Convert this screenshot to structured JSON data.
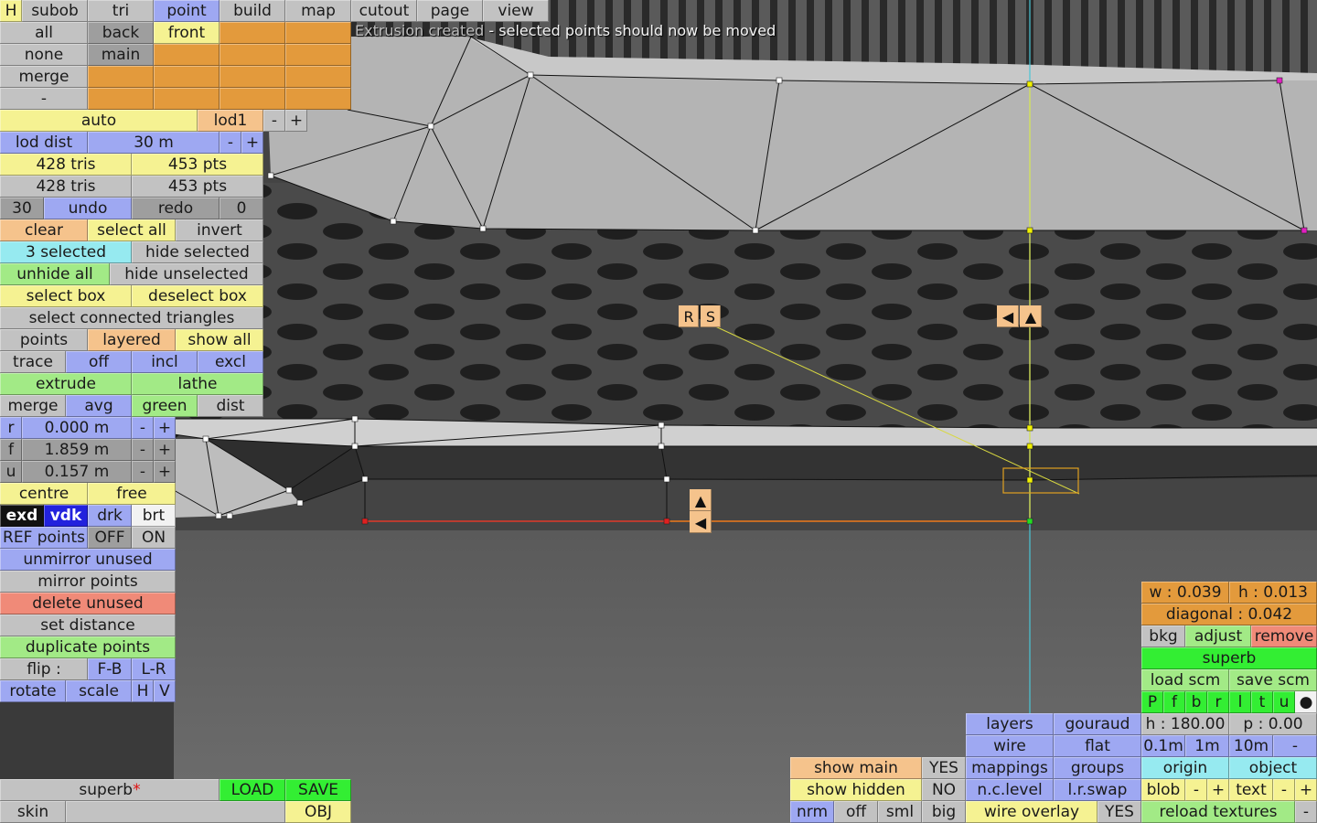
{
  "message": {
    "faded": "Extrusion created",
    "text": " - selected points should now be moved"
  },
  "menu": {
    "h": "H",
    "tabs": [
      "subob",
      "tri",
      "point",
      "build",
      "map",
      "cutout",
      "page",
      "view"
    ]
  },
  "views": {
    "all": "all",
    "back": "back",
    "front": "front",
    "none": "none",
    "main": "main",
    "merge": "merge",
    "dash": "-"
  },
  "lod": {
    "auto": "auto",
    "lod1": "lod1",
    "minus": "-",
    "plus": "+",
    "dist_label": "lod dist",
    "dist_value": "30 m"
  },
  "stats": {
    "tris1": "428 tris",
    "pts1": "453 pts",
    "tris2": "428 tris",
    "pts2": "453 pts"
  },
  "undo": {
    "count": "30",
    "undo": "undo",
    "redo": "redo",
    "redo_count": "0"
  },
  "selection": {
    "clear": "clear",
    "select_all": "select all",
    "invert": "invert",
    "selected": "3 selected",
    "hide_selected": "hide selected",
    "unhide_all": "unhide all",
    "hide_unselected": "hide unselected",
    "select_box": "select box",
    "deselect_box": "deselect box",
    "select_connected": "select connected triangles"
  },
  "display": {
    "points": "points",
    "layered": "layered",
    "show_all": "show all"
  },
  "trace": {
    "label": "trace",
    "off": "off",
    "incl": "incl",
    "excl": "excl"
  },
  "ops": {
    "extrude": "extrude",
    "lathe": "lathe",
    "merge": "merge",
    "avg": "avg",
    "green": "green",
    "dist": "dist"
  },
  "coords": [
    {
      "label": "r",
      "value": "0.000 m"
    },
    {
      "label": "f",
      "value": "1.859 m"
    },
    {
      "label": "u",
      "value": "0.157 m"
    }
  ],
  "pivot": {
    "centre": "centre",
    "free": "free"
  },
  "view_mode": {
    "exd": "exd",
    "vdk": "vdk",
    "drk": "drk",
    "brt": "brt"
  },
  "ref": {
    "label": "REF points",
    "off": "OFF",
    "on": "ON"
  },
  "actions": {
    "unmirror": "unmirror unused",
    "mirror": "mirror points",
    "delete_unused": "delete unused",
    "set_distance": "set distance",
    "duplicate": "duplicate points"
  },
  "flip": {
    "label": "flip :",
    "fb": "F-B",
    "lr": "L-R"
  },
  "transform": {
    "rotate": "rotate",
    "scale": "scale",
    "h": "H",
    "v": "V"
  },
  "file": {
    "name": "superb",
    "modified": "*",
    "load": "LOAD",
    "save": "SAVE",
    "skin": "skin",
    "obj": "OBJ"
  },
  "show": {
    "main": "show main",
    "main_val": "YES",
    "hidden": "show hidden",
    "hidden_val": "NO",
    "nrm": "nrm",
    "off": "off",
    "sml": "sml",
    "big": "big"
  },
  "render": {
    "layers": "layers",
    "gouraud": "gouraud",
    "wire": "wire",
    "flat": "flat",
    "mappings": "mappings",
    "groups": "groups",
    "nclevel": "n.c.level",
    "lrswap": "l.r.swap",
    "wire_overlay": "wire overlay",
    "wire_overlay_val": "YES"
  },
  "bkg": {
    "w": "w : 0.039",
    "h": "h : 0.013",
    "diagonal": "diagonal : 0.042",
    "bkg": "bkg",
    "adjust": "adjust",
    "remove": "remove",
    "name": "superb",
    "load_scm": "load scm",
    "save_scm": "save scm",
    "letters": [
      "P",
      "f",
      "b",
      "r",
      "l",
      "t",
      "u"
    ],
    "dot": "●",
    "heading": "h : 180.00",
    "pitch": "p : 0.00",
    "s01": "0.1m",
    "s1": "1m",
    "s10": "10m",
    "sminus": "-",
    "origin": "origin",
    "object": "object",
    "blob": "blob",
    "text": "text",
    "minus": "-",
    "plus": "+",
    "reload": "reload textures",
    "dash": "-"
  },
  "gizmo": {
    "r": "R",
    "s": "S",
    "left": "◀",
    "up": "▲"
  }
}
